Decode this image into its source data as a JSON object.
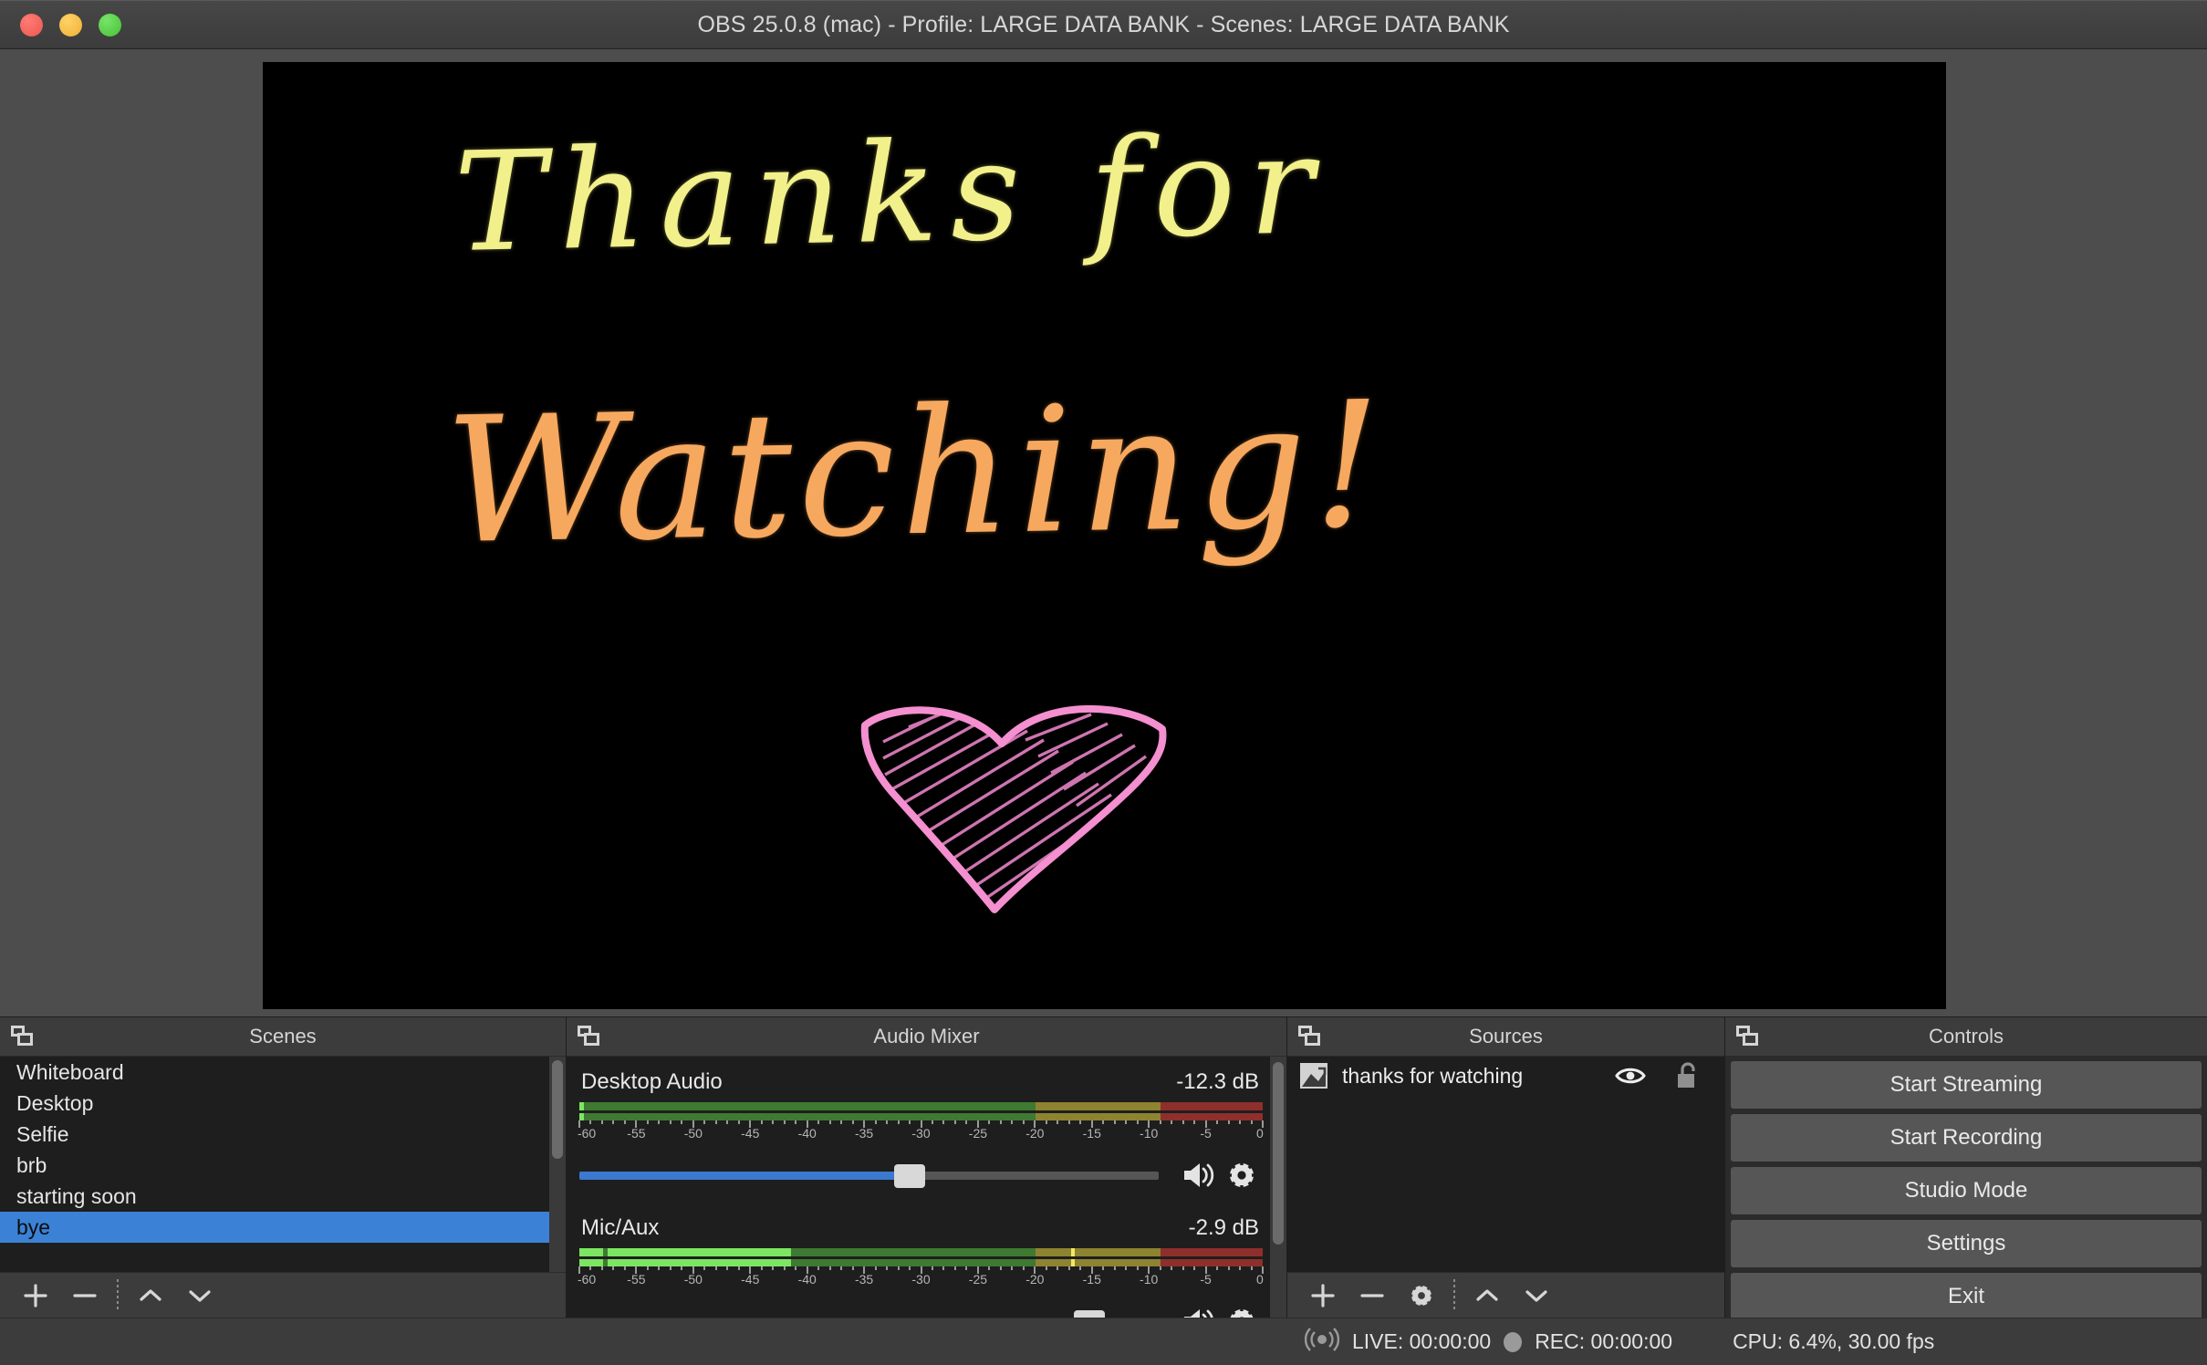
{
  "window": {
    "title": "OBS 25.0.8 (mac) - Profile: LARGE DATA BANK - Scenes: LARGE DATA BANK",
    "traffic_lights": {
      "close": "close-button",
      "minimize": "minimize-button",
      "zoom": "zoom-button"
    },
    "colors": {
      "close": "#ec5850",
      "minimize": "#efb235",
      "zoom": "#45c234",
      "accent_blue": "#3b82d6",
      "slider_blue": "#3b78cf",
      "panel_bg": "#1e1e1e",
      "chrome_bg": "#3c3c3c",
      "preview_bg": "#4d4d4d"
    }
  },
  "preview": {
    "canvas_background": "#000000",
    "artwork": {
      "line1": "Thanks for",
      "line1_color": "#f2f08a",
      "line2": "Watching!",
      "line2_color": "#f7a85f",
      "heart_color": "#f48fd0",
      "heart_name": "hand-drawn-heart"
    }
  },
  "scenes": {
    "panel_title": "Scenes",
    "items": [
      {
        "label": "Whiteboard",
        "selected": false
      },
      {
        "label": "Desktop",
        "selected": false
      },
      {
        "label": "Selfie",
        "selected": false
      },
      {
        "label": "brb",
        "selected": false
      },
      {
        "label": "starting soon",
        "selected": false
      },
      {
        "label": "bye",
        "selected": true
      }
    ],
    "toolbar": {
      "add": "+",
      "remove": "−",
      "move_up": "move-up",
      "move_down": "move-down"
    }
  },
  "mixer": {
    "panel_title": "Audio Mixer",
    "scale_labels": [
      "-60",
      "-55",
      "-50",
      "-45",
      "-40",
      "-35",
      "-30",
      "-25",
      "-20",
      "-15",
      "-10",
      "-5",
      "0"
    ],
    "tracks": [
      {
        "name": "Desktop Audio",
        "db": "-12.3 dB",
        "level_percent": 1,
        "peak_percent": null,
        "volume_percent": 57,
        "muted": false
      },
      {
        "name": "Mic/Aux",
        "db": "-2.9 dB",
        "level_percent": 31,
        "peak_percent": 72,
        "volume_percent": 88,
        "muted": false
      }
    ]
  },
  "sources": {
    "panel_title": "Sources",
    "items": [
      {
        "label": "thanks for watching",
        "visible": true,
        "locked": false
      }
    ],
    "toolbar": {
      "add": "+",
      "remove": "−",
      "properties": "properties",
      "move_up": "move-up",
      "move_down": "move-down"
    }
  },
  "controls": {
    "panel_title": "Controls",
    "buttons": [
      "Start Streaming",
      "Start Recording",
      "Studio Mode",
      "Settings",
      "Exit"
    ]
  },
  "status": {
    "live": "LIVE: 00:00:00",
    "rec": "REC: 00:00:00",
    "cpu": "CPU: 6.4%, 30.00 fps"
  }
}
